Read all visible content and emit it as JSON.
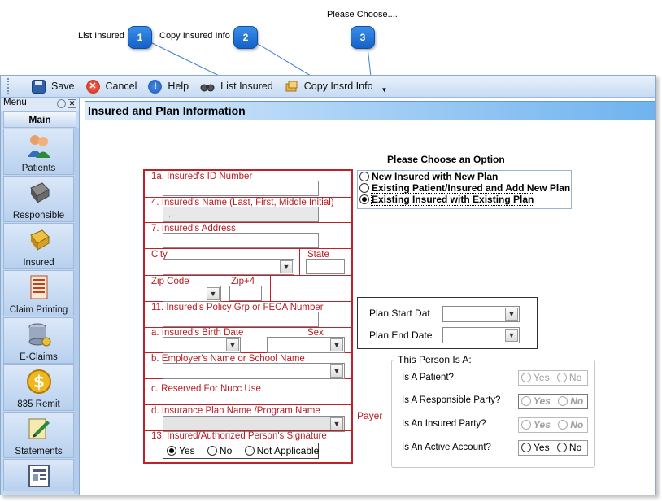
{
  "callouts": {
    "c1": {
      "label": "List Insured",
      "num": "1"
    },
    "c2": {
      "label": "Copy Insured Info",
      "num": "2"
    },
    "c3": {
      "label": "Please Choose....",
      "num": "3"
    }
  },
  "toolbar": {
    "save": "Save",
    "cancel": "Cancel",
    "help": "Help",
    "list_insured": "List Insured",
    "copy_insrd": "Copy Insrd Info"
  },
  "sidebar": {
    "menu_title": "Menu",
    "close_glyph": "✕",
    "section": "Main",
    "items": [
      {
        "label": "Patients",
        "icon": "patients-icon"
      },
      {
        "label": "Responsible",
        "icon": "book-icon"
      },
      {
        "label": "Insured",
        "icon": "insured-book-icon"
      },
      {
        "label": "Claim Printing",
        "icon": "form-icon"
      },
      {
        "label": "E-Claims",
        "icon": "database-icon"
      },
      {
        "label": "835 Remit",
        "icon": "dollar-icon"
      },
      {
        "label": "Statements",
        "icon": "statements-icon"
      },
      {
        "label": "",
        "icon": "report-icon"
      }
    ]
  },
  "header": {
    "title": "Insured and Plan Information"
  },
  "form": {
    "id_number": "1a. Insured's ID Number",
    "name": "4. Insured's Name (Last, First, Middle Initial)",
    "name_value": ",  .",
    "address": "7. Insured's Address",
    "city": "City",
    "state": "State",
    "zip": "Zip Code",
    "zip4": "Zip+4",
    "policy": "11. Insured's Policy Grp or FECA Number",
    "birth": "a. Insured's Birth Date",
    "sex": "Sex",
    "employer": "b. Employer's Name or School Name",
    "nucc": "c. Reserved For Nucc Use",
    "plan": "d. Insurance Plan Name /Program Name",
    "payer": "Payer",
    "signature": "13. Insured/Authorized Person's Signature",
    "sig_yes": "Yes",
    "sig_no": "No",
    "sig_na": "Not Applicable",
    "sig_selected": "Yes"
  },
  "options": {
    "title": "Please Choose an Option",
    "items": [
      {
        "label": "New Insured with New Plan",
        "selected": false
      },
      {
        "label": "Existing Patient/Insured and Add New Plan",
        "selected": false
      },
      {
        "label": "Existing Insured with Existing Plan",
        "selected": true
      }
    ]
  },
  "dates": {
    "start": "Plan  Start Dat",
    "end": "Plan End Date"
  },
  "person": {
    "legend": "This Person Is A:",
    "rows": [
      {
        "label": "Is A Patient?",
        "yes": "Yes",
        "no": "No"
      },
      {
        "label": "Is A Responsible Party?",
        "yes": "Yes",
        "no": "No"
      },
      {
        "label": "Is An Insured Party?",
        "yes": "Yes",
        "no": "No"
      },
      {
        "label": "Is An Active Account?",
        "yes": "Yes",
        "no": "No"
      }
    ]
  }
}
